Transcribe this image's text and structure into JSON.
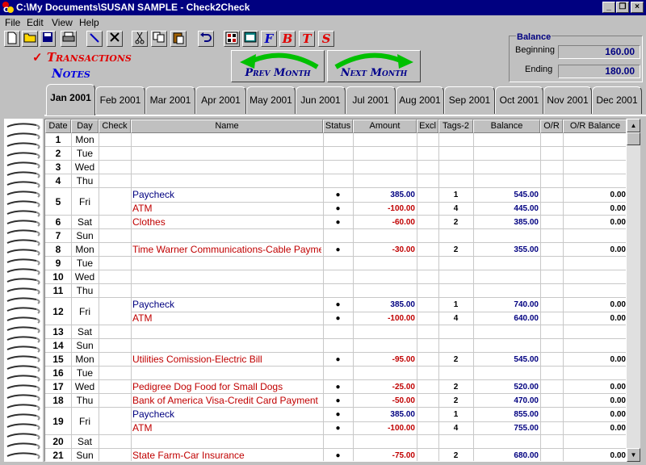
{
  "window": {
    "title": "C:\\My Documents\\SUSAN SAMPLE - Check2Check"
  },
  "menu": [
    "File",
    "Edit",
    "View",
    "Help"
  ],
  "toolbar": {
    "icons": [
      "new-file-icon",
      "open-folder-icon",
      "save-icon",
      "print-icon",
      "pencil-icon",
      "delete-x-icon",
      "cut-icon",
      "copy-icon",
      "paste-icon",
      "undo-icon",
      "calculator-icon",
      "calendar-icon",
      "font-f-icon",
      "font-b-icon",
      "font-t-icon",
      "font-s-icon"
    ],
    "letters": {
      "f": "F",
      "b": "B",
      "t": "T",
      "s": "S"
    }
  },
  "views": {
    "transactions": "Transactions",
    "notes": "Notes"
  },
  "nav": {
    "prev": "Prev Month",
    "next": "Next Month"
  },
  "balance": {
    "title": "Balance",
    "beginning_label": "Beginning",
    "beginning": "160.00",
    "ending_label": "Ending",
    "ending": "180.00"
  },
  "months": [
    "Jan 2001",
    "Feb 2001",
    "Mar 2001",
    "Apr 2001",
    "May 2001",
    "Jun 2001",
    "Jul 2001",
    "Aug 2001",
    "Sep 2001",
    "Oct 2001",
    "Nov 2001",
    "Dec 2001"
  ],
  "active_month": "Jan 2001",
  "columns": [
    "Date",
    "Day",
    "Check",
    "Name",
    "Status",
    "Amount",
    "Excl",
    "Tags-2",
    "Balance",
    "O/R",
    "O/R Balance"
  ],
  "colors": {
    "income": "#000080",
    "expense": "#c00000",
    "title": "#000080"
  },
  "days": [
    {
      "date": "1",
      "day": "Mon",
      "tx": []
    },
    {
      "date": "2",
      "day": "Tue",
      "tx": []
    },
    {
      "date": "3",
      "day": "Wed",
      "tx": []
    },
    {
      "date": "4",
      "day": "Thu",
      "tx": []
    },
    {
      "date": "5",
      "day": "Fri",
      "tx": [
        {
          "name": "Paycheck",
          "status": "●",
          "amount": "385.00",
          "tags": "1",
          "balance": "545.00",
          "orbal": "0.00",
          "type": "income"
        },
        {
          "name": "ATM",
          "status": "●",
          "amount": "-100.00",
          "tags": "4",
          "balance": "445.00",
          "orbal": "0.00",
          "type": "expense"
        }
      ]
    },
    {
      "date": "6",
      "day": "Sat",
      "tx": [
        {
          "name": "Clothes",
          "status": "●",
          "amount": "-60.00",
          "tags": "2",
          "balance": "385.00",
          "orbal": "0.00",
          "type": "expense"
        }
      ]
    },
    {
      "date": "7",
      "day": "Sun",
      "tx": []
    },
    {
      "date": "8",
      "day": "Mon",
      "tx": [
        {
          "name": "Time Warner Communications-Cable Payment",
          "status": "●",
          "amount": "-30.00",
          "tags": "2",
          "balance": "355.00",
          "orbal": "0.00",
          "type": "expense"
        }
      ]
    },
    {
      "date": "9",
      "day": "Tue",
      "tx": []
    },
    {
      "date": "10",
      "day": "Wed",
      "tx": []
    },
    {
      "date": "11",
      "day": "Thu",
      "tx": []
    },
    {
      "date": "12",
      "day": "Fri",
      "tx": [
        {
          "name": "Paycheck",
          "status": "●",
          "amount": "385.00",
          "tags": "1",
          "balance": "740.00",
          "orbal": "0.00",
          "type": "income"
        },
        {
          "name": "ATM",
          "status": "●",
          "amount": "-100.00",
          "tags": "4",
          "balance": "640.00",
          "orbal": "0.00",
          "type": "expense"
        }
      ]
    },
    {
      "date": "13",
      "day": "Sat",
      "tx": []
    },
    {
      "date": "14",
      "day": "Sun",
      "tx": []
    },
    {
      "date": "15",
      "day": "Mon",
      "tx": [
        {
          "name": "Utilities Comission-Electric Bill",
          "status": "●",
          "amount": "-95.00",
          "tags": "2",
          "balance": "545.00",
          "orbal": "0.00",
          "type": "expense"
        }
      ]
    },
    {
      "date": "16",
      "day": "Tue",
      "tx": []
    },
    {
      "date": "17",
      "day": "Wed",
      "tx": [
        {
          "name": "Pedigree Dog Food for Small Dogs",
          "status": "●",
          "amount": "-25.00",
          "tags": "2",
          "balance": "520.00",
          "orbal": "0.00",
          "type": "expense"
        }
      ]
    },
    {
      "date": "18",
      "day": "Thu",
      "tx": [
        {
          "name": "Bank of America Visa-Credit Card Payment",
          "status": "●",
          "amount": "-50.00",
          "tags": "2",
          "balance": "470.00",
          "orbal": "0.00",
          "type": "expense"
        }
      ]
    },
    {
      "date": "19",
      "day": "Fri",
      "tx": [
        {
          "name": "Paycheck",
          "status": "●",
          "amount": "385.00",
          "tags": "1",
          "balance": "855.00",
          "orbal": "0.00",
          "type": "income"
        },
        {
          "name": "ATM",
          "status": "●",
          "amount": "-100.00",
          "tags": "4",
          "balance": "755.00",
          "orbal": "0.00",
          "type": "expense"
        }
      ]
    },
    {
      "date": "20",
      "day": "Sat",
      "tx": []
    },
    {
      "date": "21",
      "day": "Sun",
      "tx": [
        {
          "name": "State Farm-Car Insurance",
          "status": "●",
          "amount": "-75.00",
          "tags": "2",
          "balance": "680.00",
          "orbal": "0.00",
          "type": "expense"
        }
      ]
    }
  ]
}
